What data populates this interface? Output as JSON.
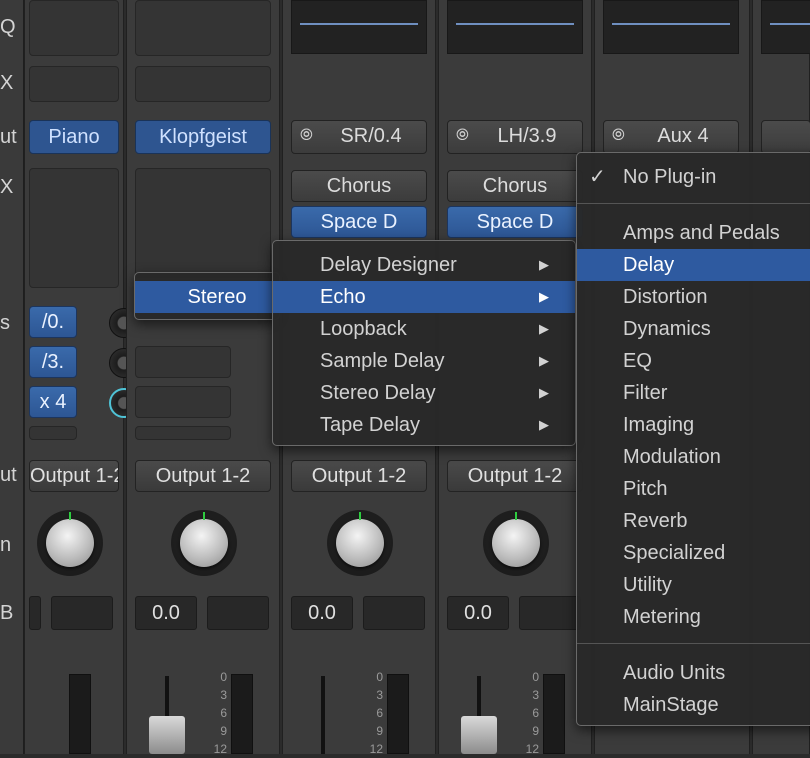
{
  "left_labels": [
    "Q",
    "X",
    "ut",
    "X",
    "s",
    "ut",
    "n",
    "B"
  ],
  "strips": [
    {
      "instrument": "Piano",
      "sends": [
        "/0.",
        "/3.",
        "x 4"
      ],
      "output": "Output 1-2",
      "volume": ""
    },
    {
      "instrument": "Klopfgeist",
      "output": "Output 1-2",
      "volume": "0.0"
    },
    {
      "input": "SR/0.4",
      "plugins": [
        "Chorus",
        "Space D"
      ],
      "output": "Output 1-2",
      "volume": "0.0"
    },
    {
      "input": "LH/3.9",
      "plugins": [
        "Chorus",
        "Space D"
      ],
      "output": "Output 1-2",
      "volume": "0.0"
    },
    {
      "input": "Aux 4"
    }
  ],
  "meter_scale": [
    "0",
    "3",
    "6",
    "9",
    "12"
  ],
  "format_menu": {
    "selected": "Stereo"
  },
  "delay_menu": {
    "items": [
      "Delay Designer",
      "Echo",
      "Loopback",
      "Sample Delay",
      "Stereo Delay",
      "Tape Delay"
    ],
    "selected_index": 1
  },
  "plugin_menu": {
    "no_plugin": "No Plug-in",
    "categories": [
      "Amps and Pedals",
      "Delay",
      "Distortion",
      "Dynamics",
      "EQ",
      "Filter",
      "Imaging",
      "Modulation",
      "Pitch",
      "Reverb",
      "Specialized",
      "Utility",
      "Metering"
    ],
    "selected_index": 1,
    "extras": [
      "Audio Units",
      "MainStage"
    ]
  },
  "colors": {
    "selection": "#2e5aa0",
    "send_knob_active": "#4fc3d6",
    "fader_tick": "#2ecc40"
  },
  "icons": {
    "checkmark": "checkmark-icon",
    "submenu_arrow": "chevron-right-icon",
    "link": "link-icon"
  }
}
